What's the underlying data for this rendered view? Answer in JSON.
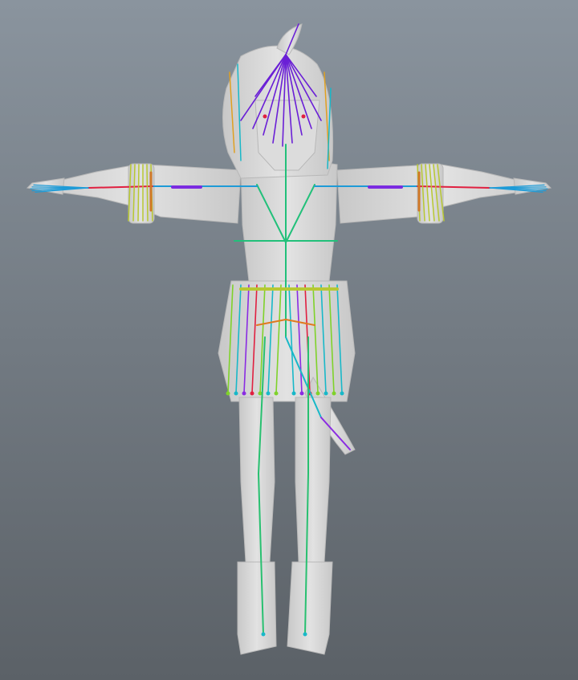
{
  "viewport": {
    "background_top": "#8a949e",
    "background_bottom": "#5b6167"
  },
  "model": {
    "body_color": "#d9d9d9",
    "body_shade": "#bdbdbd",
    "outline_color": "#c4c4c4"
  },
  "rig": {
    "bone_colors": {
      "spine": "#22c07a",
      "arm": "#1e9bd7",
      "hand": "#7b2be0",
      "hair_center": "#6a1fd6",
      "hair_side": "#e0a020",
      "skirt_green": "#7fd22a",
      "skirt_teal": "#18b8c8",
      "skirt_purple": "#8a2be2",
      "skirt_orange": "#e07a20",
      "skirt_red": "#e02040",
      "sleeve_yellow": "#b8c832",
      "sleeve_orange": "#d07828",
      "leg": "#28c070"
    }
  }
}
